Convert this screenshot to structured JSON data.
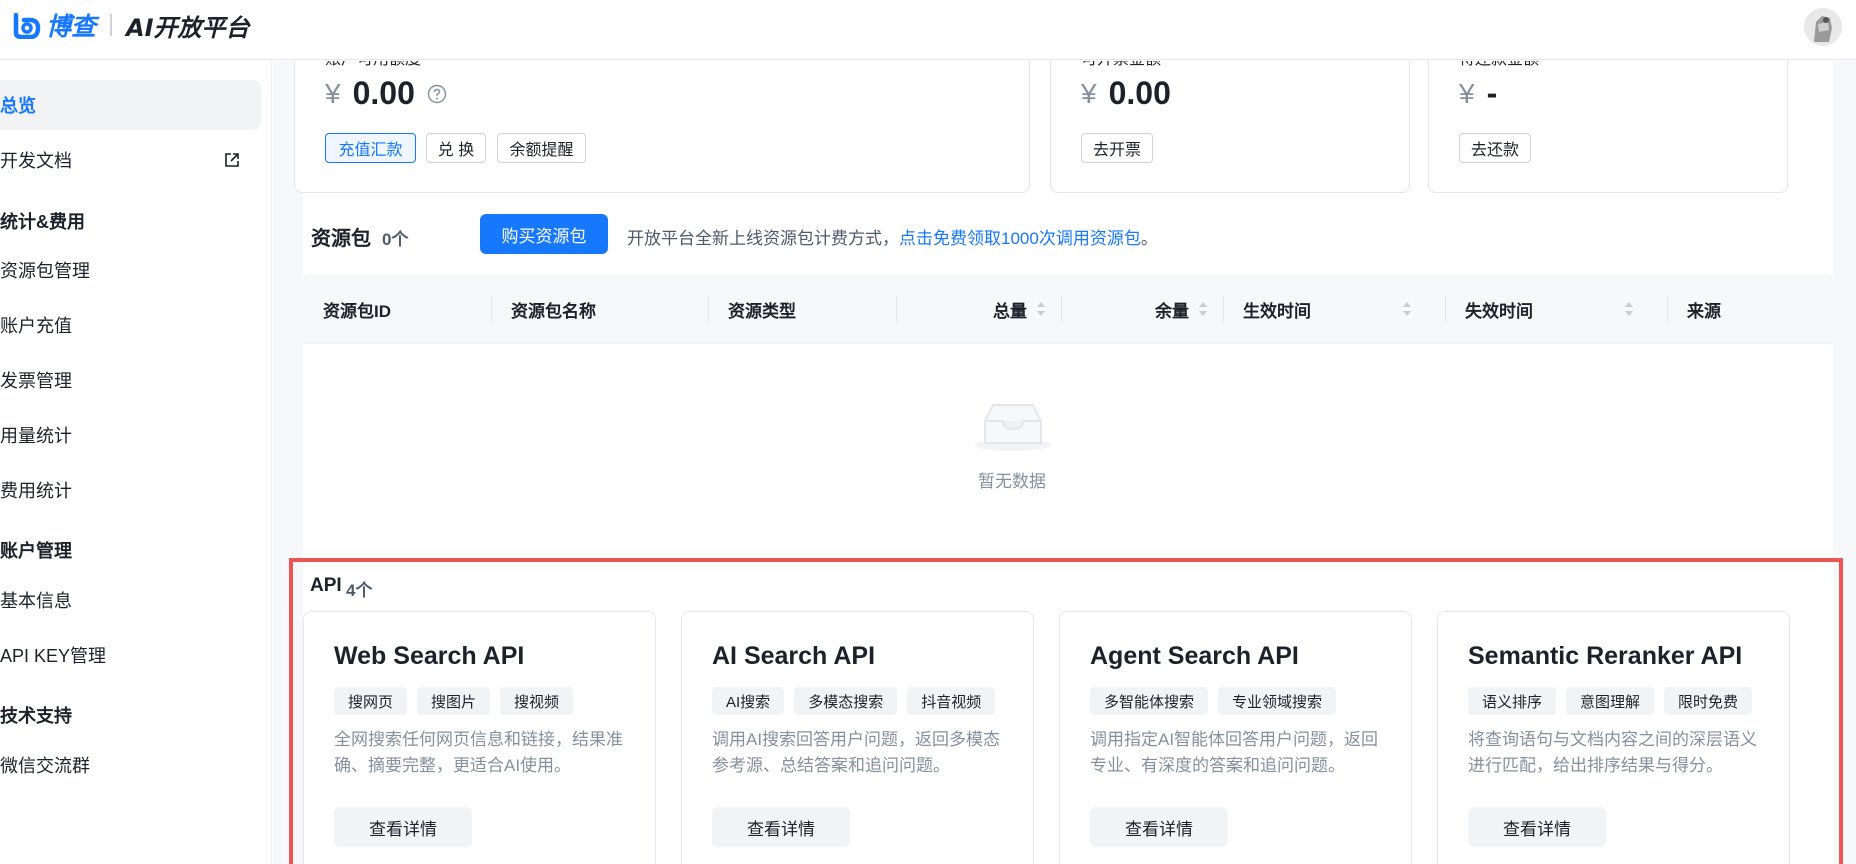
{
  "header": {
    "logo_text": "博查",
    "platform_name": "AI开放平台",
    "avatar_icon": "user-avatar-icon"
  },
  "sidebar": {
    "overview": "总览",
    "dev_docs": "开发文档",
    "group_stats": "统计&费用",
    "resource_mgmt": "资源包管理",
    "recharge": "账户充值",
    "invoice": "发票管理",
    "usage_stats": "用量统计",
    "cost_stats": "费用统计",
    "group_account": "账户管理",
    "basic_info": "基本信息",
    "api_key": "API KEY管理",
    "group_support": "技术支持",
    "wechat": "微信交流群"
  },
  "balance": {
    "available_label": "账户可用额度",
    "available_currency": "¥",
    "available_value": "0.00",
    "btn_recharge": "充值汇款",
    "btn_redeem": "兑 换",
    "btn_alert": "余额提醒",
    "invoice_label": "可开票金额",
    "invoice_currency": "¥",
    "invoice_value": "0.00",
    "btn_invoice": "去开票",
    "repay_label": "待还款金额",
    "repay_currency": "¥",
    "repay_value": "-",
    "btn_repay": "去还款"
  },
  "resources": {
    "title": "资源包",
    "count": "0个",
    "buy_button": "购买资源包",
    "notice": "开放平台全新上线资源包计费方式，",
    "notice_link": "点击免费领取1000次调用资源包",
    "notice_end": "。",
    "columns": [
      "资源包ID",
      "资源包名称",
      "资源类型",
      "总量",
      "余量",
      "生效时间",
      "失效时间",
      "来源"
    ],
    "empty_text": "暂无数据"
  },
  "api": {
    "title": "API",
    "count": "4个",
    "cards": [
      {
        "name": "Web Search API",
        "tags": [
          "搜网页",
          "搜图片",
          "搜视频"
        ],
        "desc": "全网搜索任何网页信息和链接，结果准确、摘要完整，更适合AI使用。",
        "button": "查看详情"
      },
      {
        "name": "AI Search API",
        "tags": [
          "AI搜索",
          "多模态搜索",
          "抖音视频"
        ],
        "desc": "调用AI搜索回答用户问题，返回多模态参考源、总结答案和追问问题。",
        "button": "查看详情"
      },
      {
        "name": "Agent Search API",
        "tags": [
          "多智能体搜索",
          "专业领域搜索"
        ],
        "desc": "调用指定AI智能体回答用户问题，返回专业、有深度的答案和追问问题。",
        "button": "查看详情"
      },
      {
        "name": "Semantic Reranker API",
        "tags": [
          "语义排序",
          "意图理解",
          "限时免费"
        ],
        "desc": "将查询语句与文档内容之间的深层语义进行匹配，给出排序结果与得分。",
        "button": "查看详情"
      }
    ]
  },
  "colors": {
    "brand": "#1677ff",
    "highlight_frame": "#ed5555"
  }
}
